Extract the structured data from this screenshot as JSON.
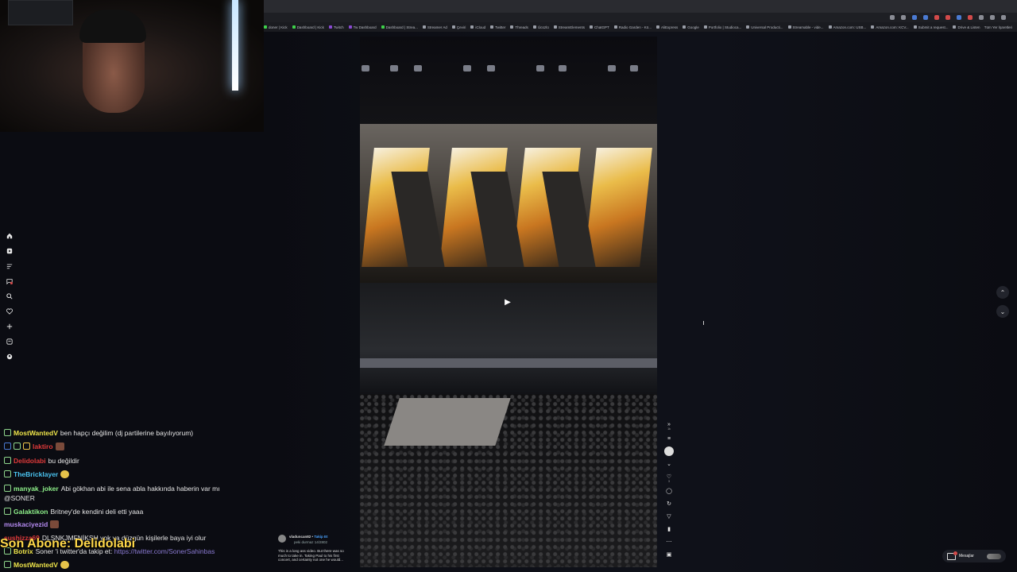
{
  "browser": {
    "bookmarks": [
      "doner | Kick",
      "Dashboard | Kick",
      "Twitch",
      "Tw Dashboard",
      "Dashboard | Strea...",
      "Streamer Ad",
      "Çeviri",
      "iCloud",
      "Twitter",
      "Threads",
      "Ücüzlü",
      "StreamElements",
      "ChatGPT",
      "Radio Garden - Kö...",
      "AliExpress",
      "Google",
      "Portfolio | Studioca...",
      "Universal Producti...",
      "Streamable - vide...",
      "Amazon.com: USB...",
      "Amazon.com: KCV...",
      "Submit a request...",
      "Drive & Listen"
    ],
    "other_bookmarks": "Tüm Yer İşaretleri"
  },
  "chat": {
    "messages": [
      {
        "user": "MostWantedV",
        "user_color": "#f0e64a",
        "text": "ben hapçı değilim (dj partilerine bayılıyorum)",
        "emote": false
      },
      {
        "user": "laktiro",
        "user_color": "#e03a3a",
        "text": "",
        "emote": true
      },
      {
        "user": "Delidolabi",
        "user_color": "#e03a3a",
        "text": "bu değildir",
        "emote": false
      },
      {
        "user": "TheBricklayer",
        "user_color": "#4ac3f0",
        "text": "",
        "emote": true
      },
      {
        "user": "manyak_joker",
        "user_color": "#8ef08a",
        "text": "Abi gökhan abi ile sena abla hakkında haberin var mı",
        "emote": false
      },
      {
        "user": "",
        "user_color": "#e6e6e6",
        "text": "@SONER",
        "emote": false
      },
      {
        "user": "Galaktikon",
        "user_color": "#8ef08a",
        "text": "Britney'de kendini deli etti yaaa",
        "emote": false
      },
      {
        "user": "muskaciyezid",
        "user_color": "#b48af0",
        "text": "",
        "emote": true
      },
      {
        "user": "sushizza69",
        "user_color": "#e03a3a",
        "text": "DLŞNKJMFNİKŞH yok ya düzgün kişilerle baya iyi olur",
        "emote": false
      },
      {
        "user": "Botrix",
        "user_color": "#f0e64a",
        "text": "Soner 'i twitter'da takip et:",
        "link": "https://twitter.com/SonerSahinbas",
        "emote": false
      },
      {
        "user": "MostWantedV",
        "user_color": "#f0e64a",
        "text": "",
        "emote": true
      }
    ],
    "sub_banner": "Son Abone: Delidolabi"
  },
  "post": {
    "author": "vladuncan82",
    "follow": "Takip Et",
    "sub": "peki durmaz 14/2802",
    "caption": "This is a long ass video. But there was so much to take in. Taking Paul to his first concert, and certainly not one he would..."
  },
  "actions": {
    "count_1": "1k",
    "count_2": "3"
  },
  "messages_pill": {
    "label": "Mesajlar"
  },
  "colors": {
    "accent_yellow": "#ffd84a",
    "link": "#8a7ad2",
    "follow_blue": "#4aa3ff"
  }
}
